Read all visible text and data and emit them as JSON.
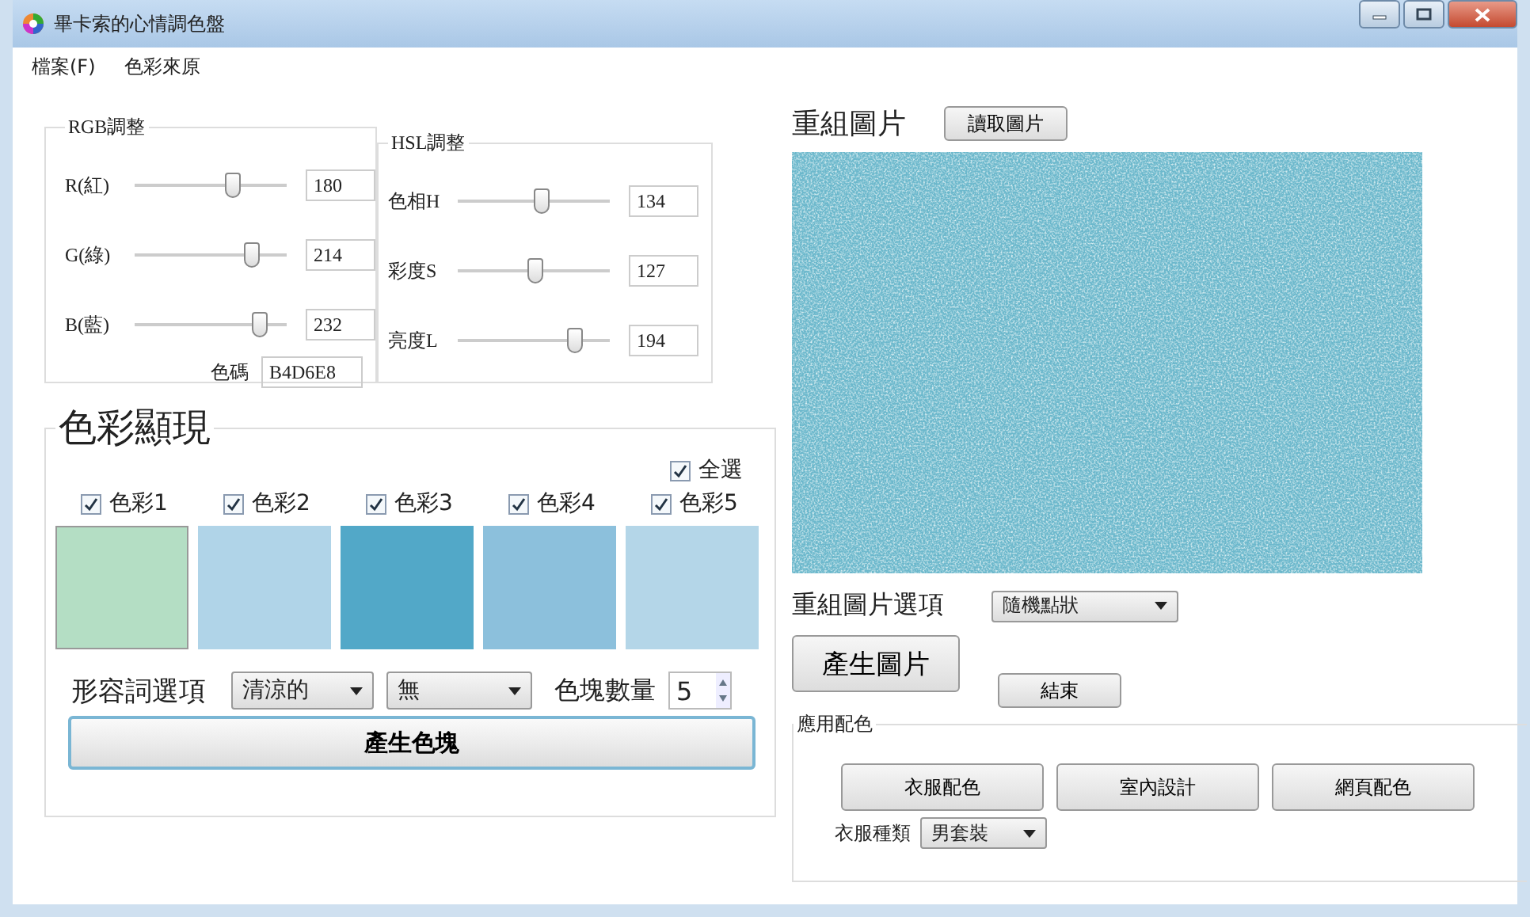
{
  "window": {
    "title": "畢卡索的心情調色盤"
  },
  "menu": [
    "檔案(F)",
    "色彩來原"
  ],
  "rgb": {
    "title": "RGB調整",
    "sliders": [
      {
        "label": "R(紅)",
        "level": 0.65,
        "value": "180"
      },
      {
        "label": "G(綠)",
        "level": 0.77,
        "value": "214"
      },
      {
        "label": "B(藍)",
        "level": 0.82,
        "value": "232"
      }
    ],
    "code_label": "色碼",
    "code_value": "B4D6E8"
  },
  "hsl": {
    "title": "HSL調整",
    "sliders": [
      {
        "label": "色相H",
        "level": 0.55,
        "value": "134"
      },
      {
        "label": "彩度S",
        "level": 0.51,
        "value": "127"
      },
      {
        "label": "亮度L",
        "level": 0.77,
        "value": "194"
      }
    ]
  },
  "display": {
    "title": "色彩顯現",
    "select_all": {
      "label": "全選",
      "checked": true
    },
    "swatches": [
      {
        "label": "色彩1",
        "checked": true,
        "color": "#b4dec4"
      },
      {
        "label": "色彩2",
        "checked": true,
        "color": "#b0d4e8"
      },
      {
        "label": "色彩3",
        "checked": true,
        "color": "#52a8c8"
      },
      {
        "label": "色彩4",
        "checked": true,
        "color": "#8cc0dc"
      },
      {
        "label": "色彩5",
        "checked": true,
        "color": "#b4d6e8"
      }
    ],
    "adjective_label": "形容詞選項",
    "adjective_1": "清涼的",
    "adjective_2": "無",
    "count_label": "色塊數量",
    "count": "5",
    "generate_button": "產生色塊"
  },
  "recompose": {
    "title": "重組圖片",
    "load_button": "讀取圖片",
    "option_label": "重組圖片選項",
    "option": "隨機點狀",
    "generate_button": "產生圖片",
    "end_button": "結束"
  },
  "apply": {
    "title": "應用配色",
    "buttons": [
      "衣服配色",
      "室內設計",
      "網頁配色"
    ],
    "clothes_label": "衣服種類",
    "clothes": "男套裝"
  }
}
